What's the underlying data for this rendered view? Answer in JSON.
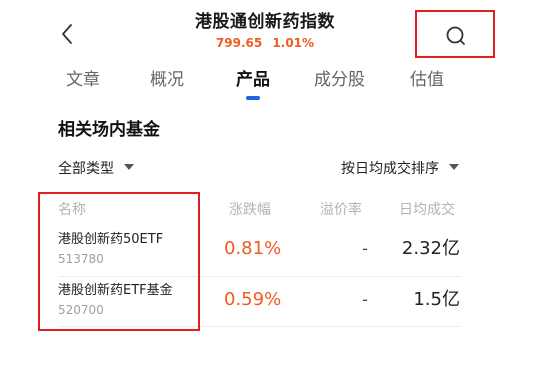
{
  "header": {
    "title": "港股通创新药指数",
    "price": "799.65",
    "change_pct": "1.01%",
    "back_icon": "chevron-left-icon",
    "search_icon": "search-icon"
  },
  "tabs": [
    {
      "label": "文章",
      "active": false
    },
    {
      "label": "概况",
      "active": false
    },
    {
      "label": "产品",
      "active": true
    },
    {
      "label": "成分股",
      "active": false
    },
    {
      "label": "估值",
      "active": false
    }
  ],
  "section_title": "相关场内基金",
  "filters": {
    "type_label": "全部类型",
    "sort_label": "按日均成交排序"
  },
  "table": {
    "columns": {
      "name": "名称",
      "change": "涨跌幅",
      "premium": "溢价率",
      "turnover": "日均成交"
    },
    "rows": [
      {
        "name": "港股创新药50ETF",
        "code": "513780",
        "change": "0.81%",
        "premium": "-",
        "turnover": "2.32亿"
      },
      {
        "name": "港股创新药ETF基金",
        "code": "520700",
        "change": "0.59%",
        "premium": "-",
        "turnover": "1.5亿"
      }
    ]
  },
  "colors": {
    "accent_up": "#f05a23",
    "tab_indicator": "#1f63e6",
    "highlight_box": "#e02020"
  }
}
